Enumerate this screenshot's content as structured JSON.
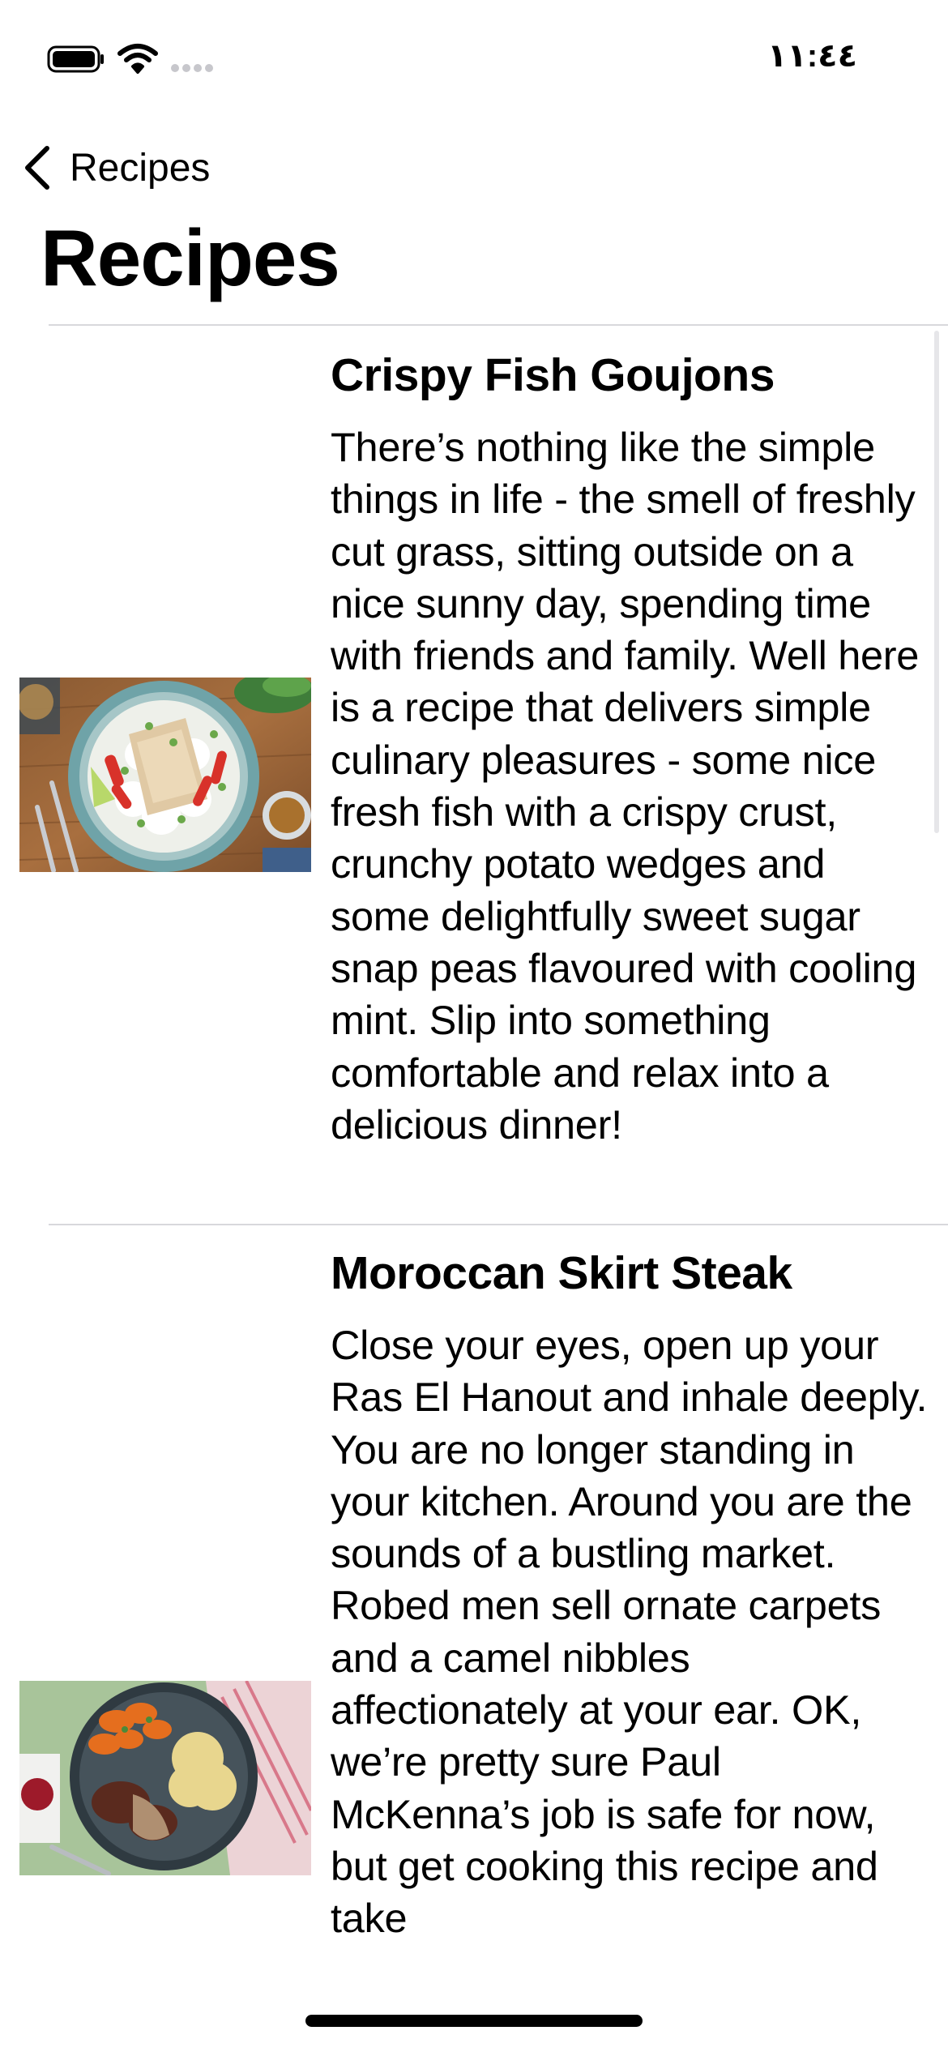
{
  "status_bar": {
    "time": "١١:٤٤",
    "icons": [
      "battery-icon",
      "wifi-icon",
      "cellular-signal-icon"
    ]
  },
  "nav": {
    "back_label": "Recipes",
    "back_icon": "chevron-left-icon",
    "title": "Recipes"
  },
  "recipes": [
    {
      "title": "Crispy Fish Goujons",
      "description": "There’s nothing like the simple things in life - the smell of freshly cut grass, sitting outside on a nice sunny day, spending time with friends and family. Well here is a recipe that delivers simple culinary pleasures - some nice fresh fish with a crispy crust, crunchy potato wedges and some delightfully sweet sugar snap peas flavoured with cooling mint. Slip into something comfortable and relax into a delicious dinner!",
      "image": "fish-dish-photo"
    },
    {
      "title": "Moroccan Skirt Steak",
      "description": "Close your eyes, open up your Ras El Hanout and inhale deeply. You are no longer standing in your kitchen. Around you are the sounds of a bustling market. Robed men sell ornate carpets and a camel nibbles affectionately at your ear.  OK, we’re pretty sure Paul McKenna’s job is safe for now, but get cooking this recipe and take",
      "image": "steak-dish-photo"
    }
  ]
}
